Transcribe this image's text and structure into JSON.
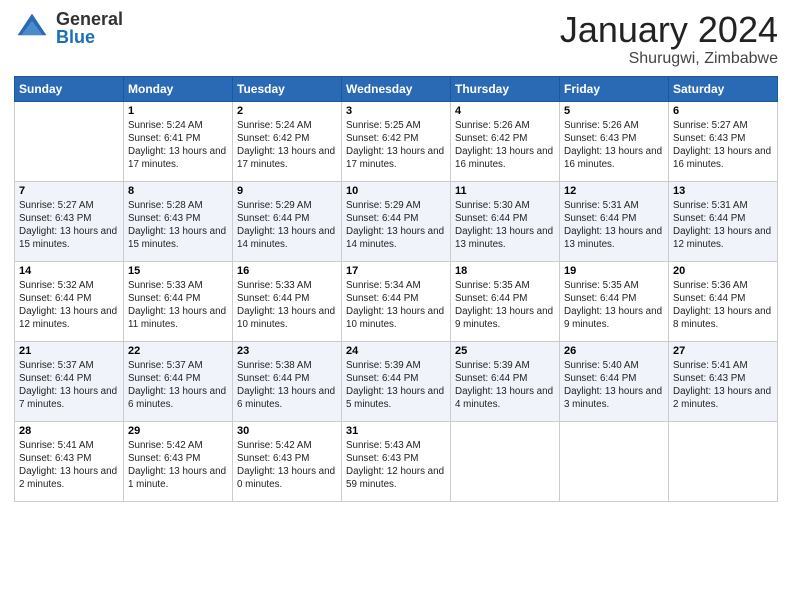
{
  "logo": {
    "general": "General",
    "blue": "Blue"
  },
  "title": {
    "month": "January 2024",
    "location": "Shurugwi, Zimbabwe"
  },
  "headers": [
    "Sunday",
    "Monday",
    "Tuesday",
    "Wednesday",
    "Thursday",
    "Friday",
    "Saturday"
  ],
  "weeks": [
    [
      {
        "num": "",
        "info": ""
      },
      {
        "num": "1",
        "info": "Sunrise: 5:24 AM\nSunset: 6:41 PM\nDaylight: 13 hours\nand 17 minutes."
      },
      {
        "num": "2",
        "info": "Sunrise: 5:24 AM\nSunset: 6:42 PM\nDaylight: 13 hours\nand 17 minutes."
      },
      {
        "num": "3",
        "info": "Sunrise: 5:25 AM\nSunset: 6:42 PM\nDaylight: 13 hours\nand 17 minutes."
      },
      {
        "num": "4",
        "info": "Sunrise: 5:26 AM\nSunset: 6:42 PM\nDaylight: 13 hours\nand 16 minutes."
      },
      {
        "num": "5",
        "info": "Sunrise: 5:26 AM\nSunset: 6:43 PM\nDaylight: 13 hours\nand 16 minutes."
      },
      {
        "num": "6",
        "info": "Sunrise: 5:27 AM\nSunset: 6:43 PM\nDaylight: 13 hours\nand 16 minutes."
      }
    ],
    [
      {
        "num": "7",
        "info": ""
      },
      {
        "num": "8",
        "info": "Sunrise: 5:28 AM\nSunset: 6:43 PM\nDaylight: 13 hours\nand 15 minutes."
      },
      {
        "num": "9",
        "info": "Sunrise: 5:29 AM\nSunset: 6:44 PM\nDaylight: 13 hours\nand 14 minutes."
      },
      {
        "num": "10",
        "info": "Sunrise: 5:29 AM\nSunset: 6:44 PM\nDaylight: 13 hours\nand 14 minutes."
      },
      {
        "num": "11",
        "info": "Sunrise: 5:30 AM\nSunset: 6:44 PM\nDaylight: 13 hours\nand 13 minutes."
      },
      {
        "num": "12",
        "info": "Sunrise: 5:31 AM\nSunset: 6:44 PM\nDaylight: 13 hours\nand 13 minutes."
      },
      {
        "num": "13",
        "info": "Sunrise: 5:31 AM\nSunset: 6:44 PM\nDaylight: 13 hours\nand 12 minutes."
      }
    ],
    [
      {
        "num": "14",
        "info": ""
      },
      {
        "num": "15",
        "info": "Sunrise: 5:33 AM\nSunset: 6:44 PM\nDaylight: 13 hours\nand 11 minutes."
      },
      {
        "num": "16",
        "info": "Sunrise: 5:33 AM\nSunset: 6:44 PM\nDaylight: 13 hours\nand 10 minutes."
      },
      {
        "num": "17",
        "info": "Sunrise: 5:34 AM\nSunset: 6:44 PM\nDaylight: 13 hours\nand 10 minutes."
      },
      {
        "num": "18",
        "info": "Sunrise: 5:35 AM\nSunset: 6:44 PM\nDaylight: 13 hours\nand 9 minutes."
      },
      {
        "num": "19",
        "info": "Sunrise: 5:35 AM\nSunset: 6:44 PM\nDaylight: 13 hours\nand 9 minutes."
      },
      {
        "num": "20",
        "info": "Sunrise: 5:36 AM\nSunset: 6:44 PM\nDaylight: 13 hours\nand 8 minutes."
      }
    ],
    [
      {
        "num": "21",
        "info": ""
      },
      {
        "num": "22",
        "info": "Sunrise: 5:37 AM\nSunset: 6:44 PM\nDaylight: 13 hours\nand 6 minutes."
      },
      {
        "num": "23",
        "info": "Sunrise: 5:38 AM\nSunset: 6:44 PM\nDaylight: 13 hours\nand 6 minutes."
      },
      {
        "num": "24",
        "info": "Sunrise: 5:39 AM\nSunset: 6:44 PM\nDaylight: 13 hours\nand 5 minutes."
      },
      {
        "num": "25",
        "info": "Sunrise: 5:39 AM\nSunset: 6:44 PM\nDaylight: 13 hours\nand 4 minutes."
      },
      {
        "num": "26",
        "info": "Sunrise: 5:40 AM\nSunset: 6:44 PM\nDaylight: 13 hours\nand 3 minutes."
      },
      {
        "num": "27",
        "info": "Sunrise: 5:41 AM\nSunset: 6:43 PM\nDaylight: 13 hours\nand 2 minutes."
      }
    ],
    [
      {
        "num": "28",
        "info": "Sunrise: 5:41 AM\nSunset: 6:43 PM\nDaylight: 13 hours\nand 2 minutes."
      },
      {
        "num": "29",
        "info": "Sunrise: 5:42 AM\nSunset: 6:43 PM\nDaylight: 13 hours\nand 1 minute."
      },
      {
        "num": "30",
        "info": "Sunrise: 5:42 AM\nSunset: 6:43 PM\nDaylight: 13 hours\nand 0 minutes."
      },
      {
        "num": "31",
        "info": "Sunrise: 5:43 AM\nSunset: 6:43 PM\nDaylight: 12 hours\nand 59 minutes."
      },
      {
        "num": "",
        "info": ""
      },
      {
        "num": "",
        "info": ""
      },
      {
        "num": "",
        "info": ""
      }
    ]
  ],
  "week1_sunday": "Sunrise: 5:27 AM\nSunset: 6:43 PM\nDaylight: 13 hours\nand 15 minutes.",
  "week2_sunday": "Sunrise: 5:27 AM\nSunset: 6:43 PM\nDaylight: 13 hours\nand 15 minutes.",
  "week3_sunday": "Sunrise: 5:32 AM\nSunset: 6:44 PM\nDaylight: 13 hours\nand 12 minutes.",
  "week4_sunday": "Sunrise: 5:37 AM\nSunset: 6:44 PM\nDaylight: 13 hours\nand 7 minutes."
}
